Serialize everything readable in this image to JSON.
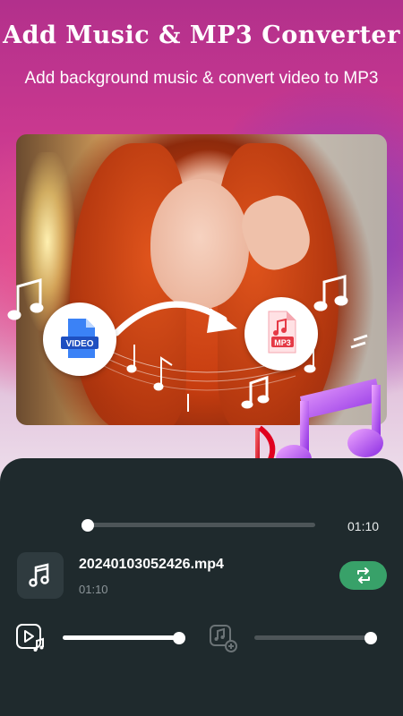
{
  "header": {
    "title": "Add Music & MP3 Converter",
    "subtitle": "Add background music & convert video to MP3"
  },
  "conversion": {
    "source_label": "VIDEO",
    "target_label": "MP3"
  },
  "player": {
    "progress": 0,
    "time": "01:10"
  },
  "file": {
    "name": "20240103052426.mp4",
    "duration": "01:10"
  },
  "volumes": {
    "video_volume": 1.0,
    "music_volume": 1.0
  },
  "colors": {
    "panel_bg": "#1f2a2d",
    "accent_green": "#38a169",
    "title_color": "#ffffff"
  },
  "icons": {
    "file": "music-note-icon",
    "swap": "swap-icon",
    "video_audio": "video-music-icon",
    "add_music": "add-music-icon"
  }
}
